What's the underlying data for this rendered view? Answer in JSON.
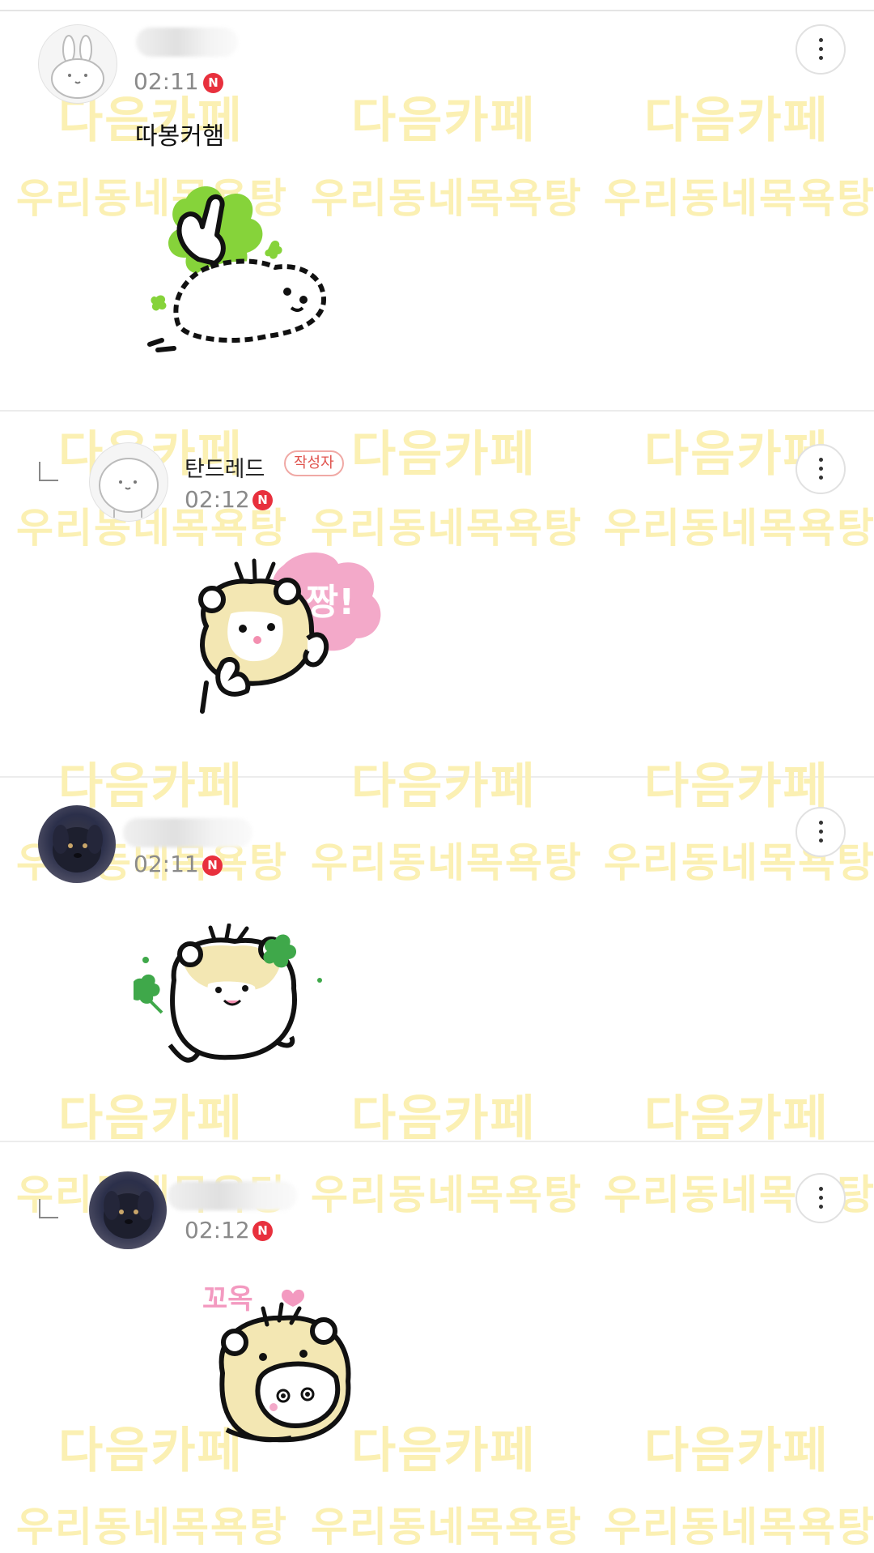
{
  "watermark": {
    "cafe": "다음카페",
    "group": "우리동네목욕탕"
  },
  "comments": [
    {
      "author": "",
      "time": "02:11",
      "new_badge": "N",
      "text": "따봉커햄",
      "is_reply": false,
      "is_author": false,
      "sticker": "thumbs-up-hamster-clover-sticker"
    },
    {
      "author": "탄드레드",
      "author_badge": "작성자",
      "time": "02:12",
      "new_badge": "N",
      "is_reply": true,
      "is_author": true,
      "sticker": "hamster-jjang-sticker",
      "sticker_text": "짱!"
    },
    {
      "author": "",
      "time": "02:11",
      "new_badge": "N",
      "is_reply": false,
      "is_author": false,
      "sticker": "hamster-clover-sticker"
    },
    {
      "author": "",
      "time": "02:12",
      "new_badge": "N",
      "is_reply": true,
      "is_author": false,
      "sticker": "hamster-hug-sticker",
      "sticker_text": "꼬옥"
    }
  ],
  "colors": {
    "new_badge": "#e8303d",
    "author_badge": "#e0534d",
    "watermark": "#fbf0b3",
    "clover": "#86d33a",
    "pink": "#f3a9c9",
    "hamster": "#f3e7b3"
  },
  "icons": [
    "more-vertical-icon",
    "reply-arrow-icon"
  ]
}
